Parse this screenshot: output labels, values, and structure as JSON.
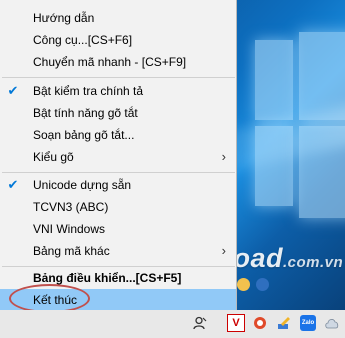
{
  "menu": {
    "items": [
      {
        "label": "Hướng dẫn"
      },
      {
        "label": "Công cụ...[CS+F6]"
      },
      {
        "label": "Chuyển mã nhanh - [CS+F9]"
      },
      {
        "label": "Bật kiểm tra chính tả",
        "checked": true
      },
      {
        "label": "Bật tính năng gõ tắt"
      },
      {
        "label": "Soạn bảng gõ tắt..."
      },
      {
        "label": "Kiểu gõ",
        "submenu": true
      },
      {
        "label": "Unicode dựng sẵn",
        "checked": true
      },
      {
        "label": "TCVN3 (ABC)"
      },
      {
        "label": "VNI Windows"
      },
      {
        "label": "Bảng mã khác",
        "submenu": true
      },
      {
        "label": "Bảng điều khiển...[CS+F5]",
        "bold": true
      },
      {
        "label": "Kết thúc",
        "selected": true
      }
    ],
    "check_glyph": "✔",
    "arrow_glyph": "›"
  },
  "watermark": {
    "brand": "Download",
    "suffix": ".com.vn"
  },
  "dot_colors": [
    "#4aa3e8",
    "#e84b4b",
    "#7bc043",
    "#f2c14e",
    "#2f6fbf"
  ],
  "tray": {
    "people_icon_glyph": "⚲",
    "v_icon_label": "V",
    "zalo_label": "Zalo"
  },
  "colors": {
    "menu_bg": "#f2f2f2",
    "selected_bg": "#91c9f7",
    "check_color": "#0078d7",
    "highlight_oval": "#c0504d"
  }
}
